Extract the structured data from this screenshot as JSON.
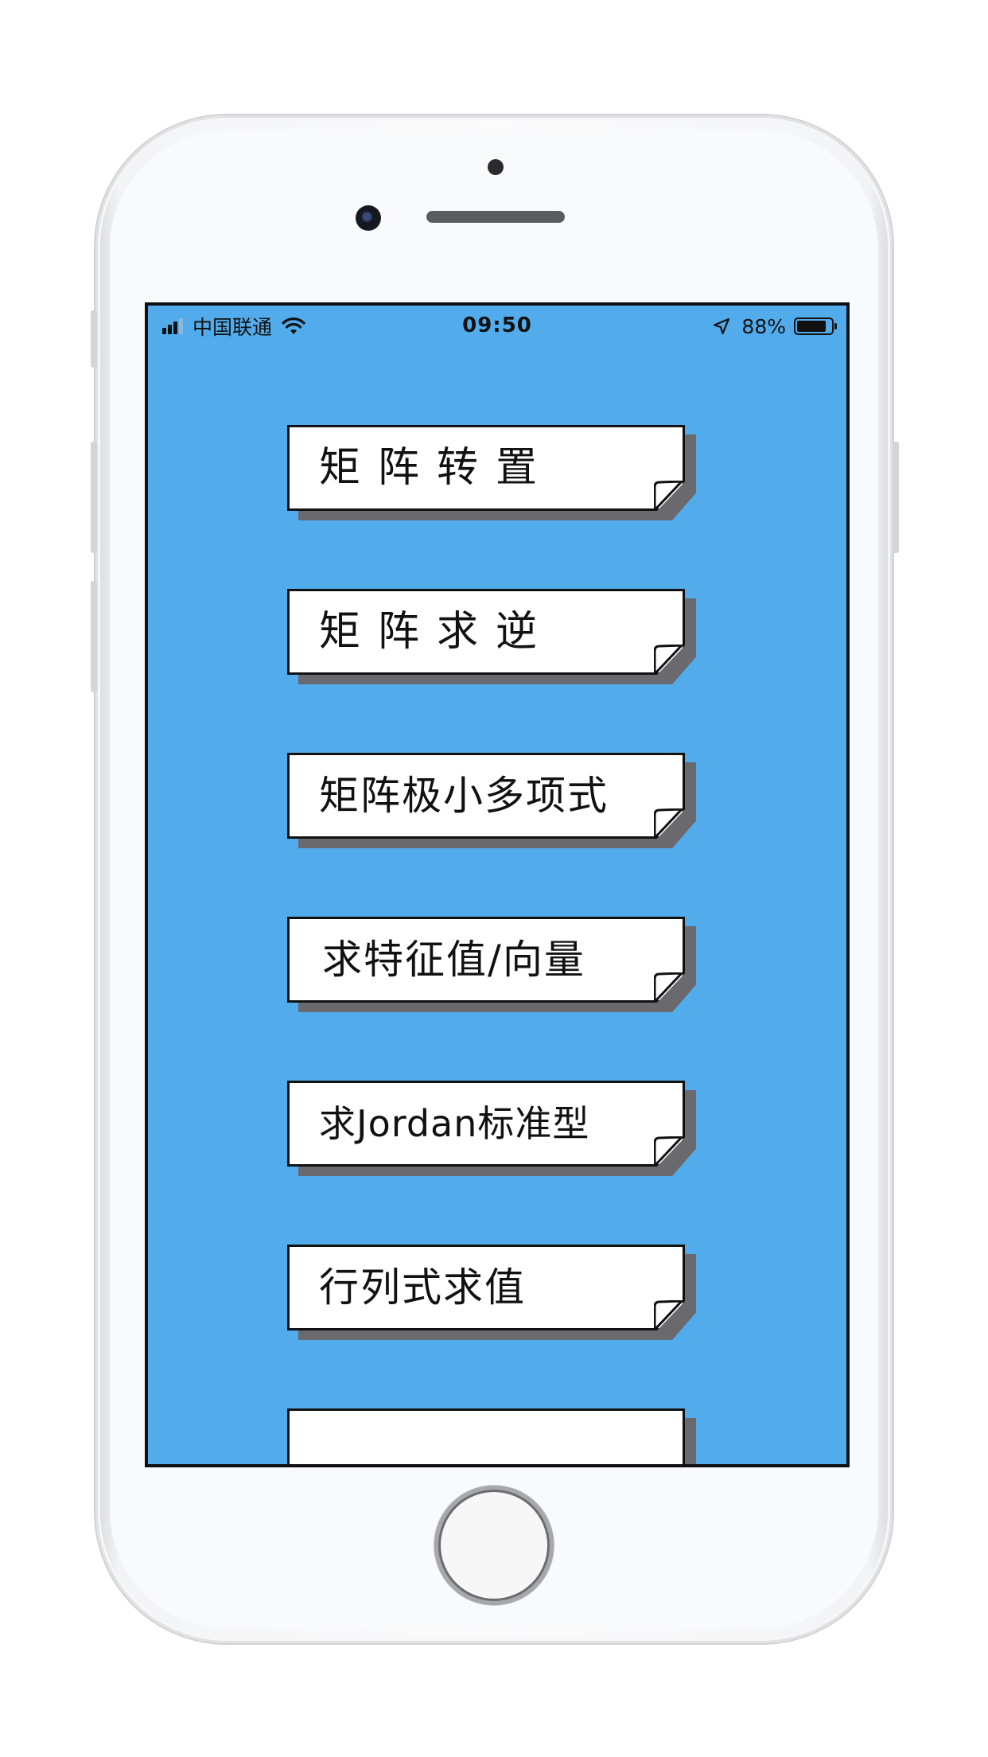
{
  "status_bar": {
    "carrier": "中国联通",
    "time": "09:50",
    "battery_percent": "88%",
    "battery_level": 0.88,
    "signal_bars_filled": 3,
    "signal_bars_total": 4,
    "icons": [
      "signal-icon",
      "wifi-icon",
      "location-arrow-icon",
      "battery-icon"
    ]
  },
  "menu": {
    "items": [
      {
        "label": "矩阵转置"
      },
      {
        "label": "矩阵求逆"
      },
      {
        "label": "矩阵极小多项式"
      },
      {
        "label": "求特征值/向量"
      },
      {
        "label": "求Jordan标准型"
      },
      {
        "label": "行列式求值"
      },
      {
        "label": ""
      }
    ]
  },
  "colors": {
    "screen_background": "#52aceb",
    "card_background": "#ffffff",
    "card_border": "#111111",
    "card_shadow": "#6a6a6e"
  }
}
